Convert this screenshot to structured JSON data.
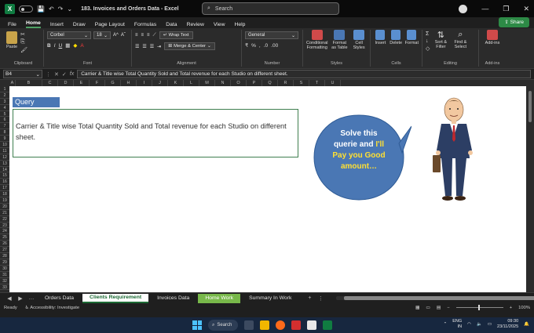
{
  "titlebar": {
    "app_logo": "X",
    "autosave_toggle": "off",
    "doc_title": "183. Invoices and Orders Data - Excel",
    "search_placeholder": "Search",
    "minimize": "—",
    "maximize": "❐",
    "close": "✕"
  },
  "menu": {
    "items": [
      "File",
      "Home",
      "Insert",
      "Draw",
      "Page Layout",
      "Formulas",
      "Data",
      "Review",
      "View",
      "Help"
    ],
    "active": "Home",
    "share_label": "Share"
  },
  "ribbon": {
    "paste": "Paste",
    "clipboard_label": "Clipboard",
    "font_name": "Corbel",
    "font_size": "18",
    "font_label": "Font",
    "wrap_text": "Wrap Text",
    "merge_center": "Merge & Center",
    "alignment_label": "Alignment",
    "number_format": "General",
    "number_label": "Number",
    "conditional_formatting": "Conditional Formatting",
    "format_as_table": "Format as Table",
    "cell_styles": "Cell Styles",
    "styles_label": "Styles",
    "insert": "Insert",
    "delete": "Delete",
    "format": "Format",
    "cells_label": "Cells",
    "sort_filter": "Sort & Filter",
    "find_select": "Find & Select",
    "editing_label": "Editing",
    "addins": "Add-ins",
    "addins_label": "Add-ins",
    "accent": "#4ea163"
  },
  "formula_bar": {
    "name_box": "B4",
    "fx": "fx",
    "content": "Carrier & Title wise Total Quantity Sold and Total revenue for each Studio on different sheet."
  },
  "grid": {
    "columns": [
      "A",
      "B",
      "C",
      "D",
      "E",
      "F",
      "G",
      "H",
      "I",
      "J",
      "K",
      "L",
      "M",
      "N",
      "O",
      "P",
      "Q",
      "R",
      "S",
      "T",
      "U"
    ],
    "rows": [
      "1",
      "2",
      "3",
      "4",
      "5",
      "6",
      "7",
      "8",
      "9",
      "10",
      "11",
      "12",
      "13",
      "14",
      "15",
      "16",
      "17",
      "18",
      "19",
      "20",
      "21",
      "22",
      "23",
      "24",
      "25",
      "26",
      "27",
      "28",
      "29",
      "30",
      "31",
      "32",
      "33"
    ],
    "query_heading": "Query",
    "query_text": "Carrier & Title wise Total Quantity Sold and Total revenue for each Studio on different sheet.",
    "bubble_line1": "Solve this",
    "bubble_line2a": "querie and ",
    "bubble_line2b": "I'll",
    "bubble_line3": "Pay you Good",
    "bubble_line4": "amount…",
    "bubble_color": "#4a77b4",
    "highlight_color": "#ffe033"
  },
  "sheets": {
    "tabs": [
      "Orders Data",
      "Clients Requirement",
      "Invoices Data",
      "Home Work",
      "Summary In Work"
    ],
    "active": "Clients Requirement",
    "green": "Home Work",
    "add": "+"
  },
  "status": {
    "ready": "Ready",
    "accessibility": "Accessibility: Investigate",
    "zoom": "100%"
  },
  "taskbar": {
    "search": "Search",
    "lang_top": "ENG",
    "lang_bottom": "IN",
    "time": "09:30",
    "date": "23/11/2025"
  }
}
